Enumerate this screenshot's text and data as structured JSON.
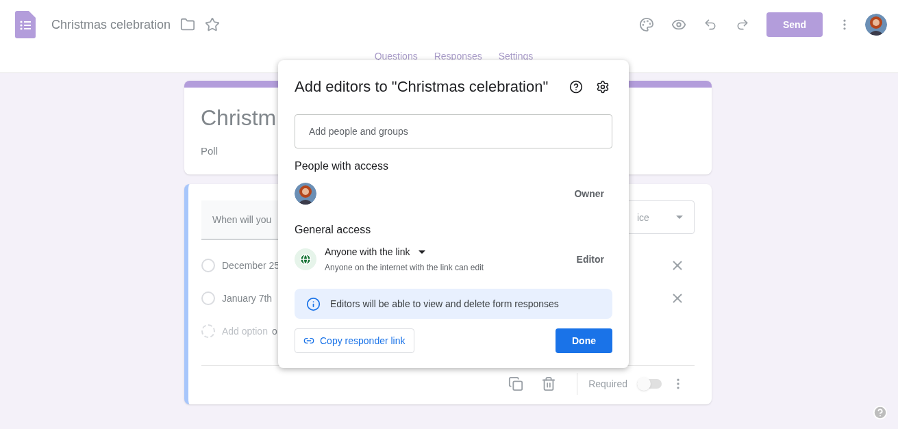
{
  "header": {
    "title": "Christmas celebration",
    "send_button": "Send"
  },
  "tabs": [
    {
      "label": "Questions"
    },
    {
      "label": "Responses"
    },
    {
      "label": "Settings"
    }
  ],
  "title_card": {
    "title": "Christm",
    "description": "Poll"
  },
  "question_card": {
    "question": "When will you",
    "type": "ice",
    "options": [
      {
        "label": "December 25",
        "selected": false
      },
      {
        "label": "January 7th",
        "selected": false
      }
    ],
    "add_option": "Add option",
    "add_other": "o",
    "required_label": "Required",
    "required_on": false
  },
  "dialog": {
    "title": "Add editors to \"Christmas celebration\"",
    "search": {
      "placeholder": "Add people and groups"
    },
    "people_heading": "People with access",
    "people": [
      {
        "role": "Owner"
      }
    ],
    "general_heading": "General access",
    "access": {
      "label": "Anyone with the link",
      "description": "Anyone on the internet with the link can edit",
      "role": "Editor"
    },
    "notice": "Editors will be able to view and delete form responses",
    "copy_link_button": "Copy responder link",
    "done_button": "Done"
  }
}
